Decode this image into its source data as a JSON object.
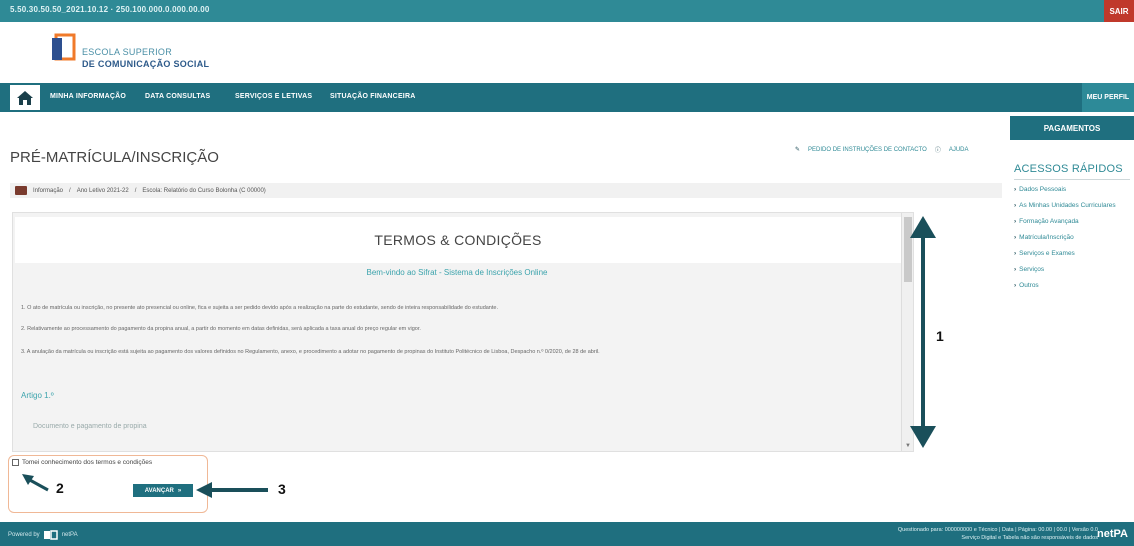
{
  "topbar": {
    "left_text": "5.50.30.50.50_2021.10.12 · 250.100.000.0.000.00.00",
    "logout_label": "SAIR"
  },
  "logo": {
    "line1": "ESCOLA SUPERIOR",
    "line2": "DE COMUNICAÇÃO SOCIAL"
  },
  "nav": {
    "items": [
      "MINHA INFORMAÇÃO",
      "DATA CONSULTAS",
      "SERVIÇOS E LETIVAS",
      "SITUAÇÃO FINANCEIRA"
    ],
    "right_label": "MEU PERFIL"
  },
  "top_links": {
    "link1": "PEDIDO DE INSTRUÇÕES DE CONTACTO",
    "link2": "AJUDA"
  },
  "sidebar": {
    "pay_button": "PAGAMENTOS",
    "title": "ACESSOS RÁPIDOS",
    "items": [
      "Dados Pessoais",
      "As Minhas Unidades Curriculares",
      "Formação Avançada",
      "Matrícula/Inscrição",
      "Serviços e Exames",
      "Serviços",
      "Outros"
    ]
  },
  "page": {
    "title": "PRÉ-MATRÍCULA/INSCRIÇÃO"
  },
  "breadcrumb": {
    "items": [
      "Informação",
      "Ano Letivo 2021-22",
      "Escola: Relatório do Curso Bolonha (C 00000)"
    ]
  },
  "terms": {
    "title": "TERMOS & CONDIÇÕES",
    "subtitle": "Bem-vindo ao Sifrat - Sistema de Inscrições Online",
    "p1": "1. O ato de matrícula ou inscrição, no presente ato presencial ou online, fica e sujeita a ser pedido devido após a realização na parte do estudante, sendo de inteira responsabilidade do estudante.",
    "p2": "2. Relativamente ao processamento do pagamento da propina anual, a partir do momento em datas definidas, será aplicada a taxa anual do preço regular em vigor.",
    "p3": "3. A anulação da matrícula ou inscrição está sujeita ao pagamento dos valores definidos no Regulamento, anexo, e procedimento a adotar no pagamento de propinas do Instituto Politécnico de Lisboa, Despacho n.º 0/2020, de 28 de abril.",
    "article": "Artigo 1.º",
    "article_sub": "Documento e pagamento de propina"
  },
  "annotations": {
    "n1": "1",
    "n2": "2",
    "n3": "3"
  },
  "accept": {
    "checkbox_label": "Tomei conhecimento dos termos e condições",
    "next_button": "AVANÇAR"
  },
  "footer": {
    "powered": "Powered by",
    "powered_brand": "netPA",
    "right_line1": "Questionado para: 000000000 e Técnico | Data | Página: 00.00 | 00.0 | Versão 0.0",
    "right_line2": "Serviço Digital e Tabela não são responsáveis de dados",
    "brand": "netPA"
  },
  "colors": {
    "primary": "#1f6f7f",
    "accent": "#2f8a96",
    "logout": "#c0392b",
    "annotation_frame": "#f0b896"
  }
}
